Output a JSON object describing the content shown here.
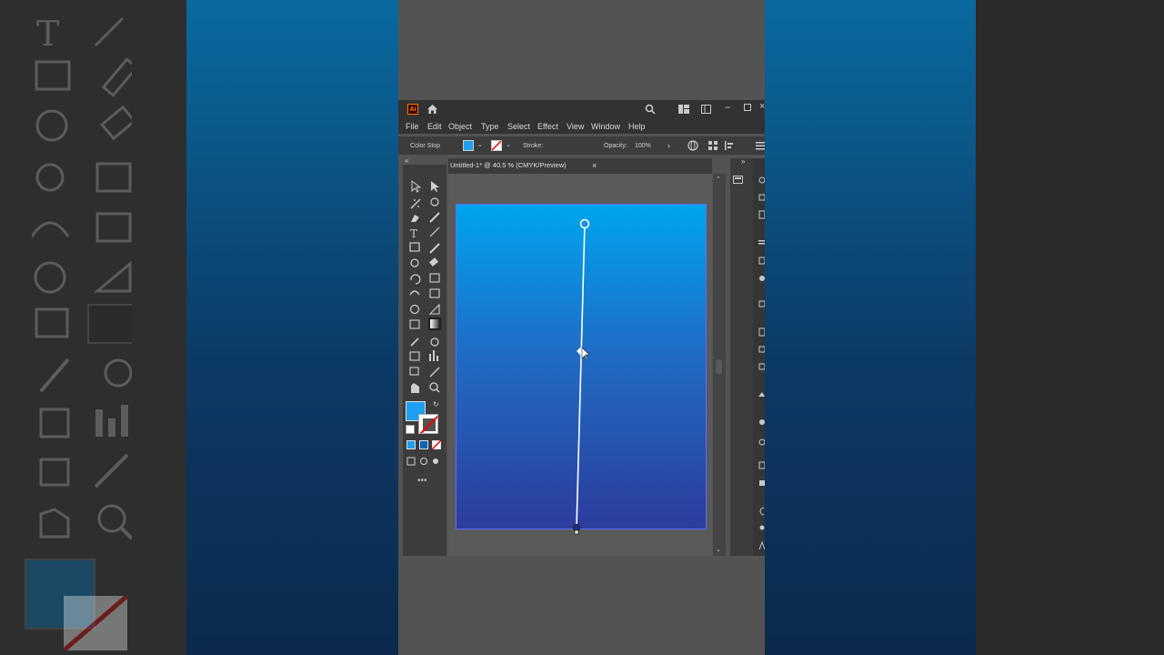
{
  "menu": [
    "File",
    "Edit",
    "Object",
    "Type",
    "Select",
    "Effect",
    "View",
    "Window",
    "Help"
  ],
  "app": {
    "logo": "Ai"
  },
  "control_bar": {
    "mode_label": "Color Stop",
    "stroke_label": "Stroke:",
    "opacity_label": "Opacity:",
    "opacity_value": "100%"
  },
  "document": {
    "tab_title": "Untitled-1* @ 40.5 % (CMYK/Preview)",
    "close": "×"
  },
  "colors": {
    "fill": "#1e9ff0",
    "gradient_start": "#00a5ee",
    "gradient_end": "#2c3c9c",
    "interface_dark": "#323232"
  },
  "icons": [
    "home-icon",
    "search-icon",
    "arrange-icon",
    "minimize-icon",
    "maximize-icon",
    "close-icon"
  ],
  "toolbox_more": "•••"
}
